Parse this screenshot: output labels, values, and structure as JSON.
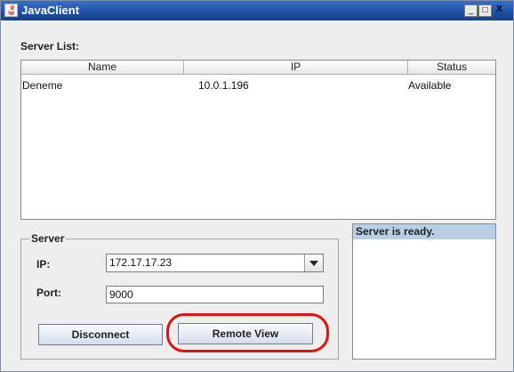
{
  "window": {
    "title": "JavaClient",
    "minimize": "_",
    "maximize": "□",
    "close": "X"
  },
  "server_list": {
    "label": "Server List:",
    "columns": [
      "Name",
      "IP",
      "Status"
    ],
    "rows": [
      {
        "name": "Deneme",
        "ip": "10.0.1.196",
        "status": "Available"
      }
    ]
  },
  "server_group": {
    "title": "Server",
    "ip_label": "IP:",
    "ip_value": "172.17.17.23",
    "port_label": "Port:",
    "port_value": "9000",
    "disconnect_label": "Disconnect",
    "remote_view_label": "Remote View"
  },
  "status_panel": {
    "header": "Server is ready."
  },
  "colors": {
    "highlight": "#e11212",
    "titlebar": "#1d4fa6",
    "status_header": "#b8cfe5"
  }
}
